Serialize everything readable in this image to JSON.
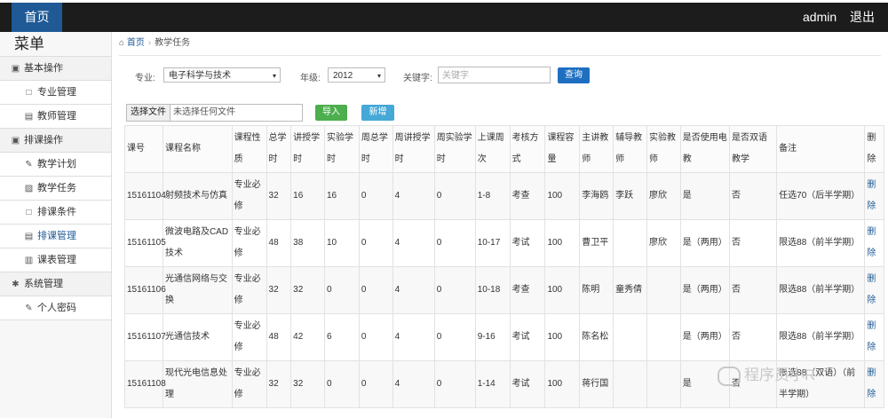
{
  "topbar": {
    "home": "首页",
    "user": "admin",
    "logout": "退出"
  },
  "sidebar": {
    "title": "菜单",
    "groups": [
      {
        "label": "基本操作",
        "items": [
          {
            "label": "专业管理"
          },
          {
            "label": "教师管理"
          }
        ]
      },
      {
        "label": "排课操作",
        "items": [
          {
            "label": "教学计划"
          },
          {
            "label": "教学任务"
          },
          {
            "label": "排课条件"
          },
          {
            "label": "排课管理"
          },
          {
            "label": "课表管理"
          }
        ]
      },
      {
        "label": "系统管理",
        "items": [
          {
            "label": "个人密码"
          }
        ]
      }
    ]
  },
  "breadcrumb": {
    "home": "首页",
    "current": "教学任务"
  },
  "filter": {
    "major_label": "专业:",
    "major_value": "电子科学与技术",
    "grade_label": "年级:",
    "grade_value": "2012",
    "keyword_label": "关键字:",
    "keyword_placeholder": "关键字",
    "query_button": "查询"
  },
  "upload": {
    "choose_file": "选择文件",
    "no_file": "未选择任何文件",
    "import_button": "导入",
    "new_button": "新增"
  },
  "table": {
    "headers": [
      "课号",
      "课程名称",
      "课程性质",
      "总学时",
      "讲授学时",
      "实验学时",
      "周总学时",
      "周讲授学时",
      "周实验学时",
      "上课周次",
      "考核方式",
      "课程容量",
      "主讲教师",
      "辅导教师",
      "实验教师",
      "是否使用电教",
      "是否双语教学",
      "备注",
      "删除"
    ],
    "rows": [
      [
        "15161104",
        "射频技术与仿真",
        "专业必修",
        "32",
        "16",
        "16",
        "0",
        "4",
        "0",
        "1-8",
        "考查",
        "100",
        "李海鸥",
        "李跃",
        "廖欣",
        "是",
        "否",
        "任选70（后半学期）",
        "删除"
      ],
      [
        "15161105",
        "微波电路及CAD技术",
        "专业必修",
        "48",
        "38",
        "10",
        "0",
        "4",
        "0",
        "10-17",
        "考试",
        "100",
        "曹卫平",
        "",
        "廖欣",
        "是（两用）",
        "否",
        "限选88（前半学期）",
        "删除"
      ],
      [
        "15161106",
        "光通信网络与交换",
        "专业必修",
        "32",
        "32",
        "0",
        "0",
        "4",
        "0",
        "10-18",
        "考查",
        "100",
        "陈明",
        "童秀倩",
        "",
        "是（两用）",
        "否",
        "限选88（前半学期）",
        "删除"
      ],
      [
        "15161107",
        "光通信技术",
        "专业必修",
        "48",
        "42",
        "6",
        "0",
        "4",
        "0",
        "9-16",
        "考试",
        "100",
        "陈名松",
        "",
        "",
        "是（两用）",
        "否",
        "限选88（前半学期）",
        "删除"
      ],
      [
        "15161108",
        "现代光电信息处理",
        "专业必修",
        "32",
        "32",
        "0",
        "0",
        "4",
        "0",
        "1-14",
        "考试",
        "100",
        "蒋行国",
        "",
        "",
        "是",
        "否",
        "限选88（双语）（前半学期）",
        "删除"
      ]
    ]
  },
  "watermark": "程序员小R",
  "colors": {
    "topbar": "#1c1c1c",
    "home_tab": "#1f5a96",
    "query": "#1f6fc1",
    "import": "#4cae4c",
    "new": "#46a8d6"
  }
}
